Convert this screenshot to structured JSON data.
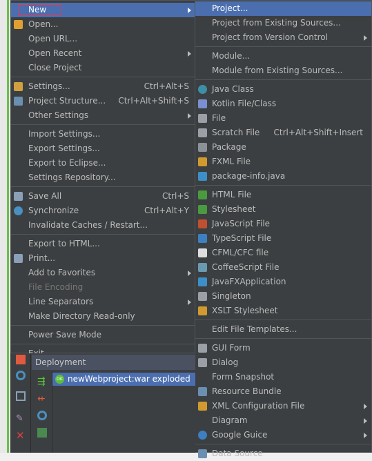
{
  "main_menu": [
    {
      "label": "New",
      "submenu": true,
      "highlighted": true
    },
    {
      "label": "Open...",
      "icon": "folder-open-icon",
      "icon_color": "#e0a030"
    },
    {
      "label": "Open URL..."
    },
    {
      "label": "Open Recent",
      "submenu": true
    },
    {
      "label": "Close Project"
    },
    {
      "sep": true
    },
    {
      "label": "Settings...",
      "shortcut": "Ctrl+Alt+S",
      "icon": "settings-wrench-icon",
      "icon_color": "#d0a040"
    },
    {
      "label": "Project Structure...",
      "shortcut": "Ctrl+Alt+Shift+S",
      "icon": "project-structure-icon",
      "icon_color": "#6a8fb0"
    },
    {
      "label": "Other Settings",
      "submenu": true
    },
    {
      "sep": true
    },
    {
      "label": "Import Settings..."
    },
    {
      "label": "Export Settings..."
    },
    {
      "label": "Export to Eclipse..."
    },
    {
      "label": "Settings Repository..."
    },
    {
      "sep": true
    },
    {
      "label": "Save All",
      "shortcut": "Ctrl+S",
      "icon": "save-icon",
      "icon_color": "#8aa0b8"
    },
    {
      "label": "Synchronize",
      "shortcut": "Ctrl+Alt+Y",
      "icon": "synchronize-icon",
      "icon_color": "#4a90c0"
    },
    {
      "label": "Invalidate Caches / Restart..."
    },
    {
      "sep": true
    },
    {
      "label": "Export to HTML..."
    },
    {
      "label": "Print...",
      "icon": "print-icon",
      "icon_color": "#8aa0b8"
    },
    {
      "label": "Add to Favorites",
      "submenu": true
    },
    {
      "label": "File Encoding",
      "disabled": true
    },
    {
      "label": "Line Separators",
      "submenu": true
    },
    {
      "label": "Make Directory Read-only"
    },
    {
      "sep": true
    },
    {
      "label": "Power Save Mode"
    },
    {
      "sep": true
    },
    {
      "label": "Exit"
    }
  ],
  "new_submenu": [
    {
      "label": "Project...",
      "highlighted": true
    },
    {
      "label": "Project from Existing Sources..."
    },
    {
      "label": "Project from Version Control",
      "submenu": true
    },
    {
      "sep": true
    },
    {
      "label": "Module..."
    },
    {
      "label": "Module from Existing Sources..."
    },
    {
      "sep": true
    },
    {
      "label": "Java Class",
      "icon": "java-class-icon",
      "icon_color": "#3d8fa8"
    },
    {
      "label": "Kotlin File/Class",
      "icon": "kotlin-file-icon",
      "icon_color": "#7a8fd0"
    },
    {
      "label": "File",
      "icon": "file-icon",
      "icon_color": "#9aa0a6"
    },
    {
      "label": "Scratch File",
      "shortcut": "Ctrl+Alt+Shift+Insert",
      "icon": "scratch-file-icon",
      "icon_color": "#9aa0a6"
    },
    {
      "label": "Package",
      "icon": "package-icon",
      "icon_color": "#8a9298"
    },
    {
      "label": "FXML File",
      "icon": "fxml-file-icon",
      "icon_color": "#d09a30"
    },
    {
      "label": "package-info.java",
      "icon": "java-file-icon",
      "icon_color": "#3d8fc8"
    },
    {
      "sep": true
    },
    {
      "label": "HTML File",
      "icon": "html-file-icon",
      "icon_color": "#4a9a40"
    },
    {
      "label": "Stylesheet",
      "icon": "css-file-icon",
      "icon_color": "#4a9a40"
    },
    {
      "label": "JavaScript File",
      "icon": "javascript-file-icon",
      "icon_color": "#c05030"
    },
    {
      "label": "TypeScript File",
      "icon": "typescript-file-icon",
      "icon_color": "#3d7fc0"
    },
    {
      "label": "CFML/CFC file",
      "icon": "cfml-file-icon",
      "icon_color": "#dddddd"
    },
    {
      "label": "CoffeeScript File",
      "icon": "coffeescript-file-icon",
      "icon_color": "#6a9ab0"
    },
    {
      "label": "JavaFXApplication",
      "icon": "javafx-icon",
      "icon_color": "#3d8fc8"
    },
    {
      "label": "Singleton",
      "icon": "singleton-icon",
      "icon_color": "#9aa0a6"
    },
    {
      "label": "XSLT Stylesheet",
      "icon": "xslt-file-icon",
      "icon_color": "#d09a30"
    },
    {
      "sep": true
    },
    {
      "label": "Edit File Templates..."
    },
    {
      "sep": true
    },
    {
      "label": "GUI Form",
      "icon": "gui-form-icon",
      "icon_color": "#9aa0a6"
    },
    {
      "label": "Dialog",
      "icon": "dialog-icon",
      "icon_color": "#9aa0a6"
    },
    {
      "label": "Form Snapshot"
    },
    {
      "label": "Resource Bundle",
      "icon": "resource-bundle-icon",
      "icon_color": "#6a8fb0"
    },
    {
      "label": "XML Configuration File",
      "submenu": true,
      "icon": "xml-file-icon",
      "icon_color": "#d09a30"
    },
    {
      "label": "Diagram",
      "submenu": true
    },
    {
      "label": "Google Guice",
      "submenu": true,
      "icon": "google-guice-icon",
      "icon_color": "#3d7fc0"
    },
    {
      "sep": true
    },
    {
      "label": "Data Source",
      "icon": "database-icon",
      "icon_color": "#6a8fb0"
    }
  ],
  "deployment": {
    "title": "Deployment",
    "item": "newWebproject:war exploded",
    "status": "OK"
  }
}
